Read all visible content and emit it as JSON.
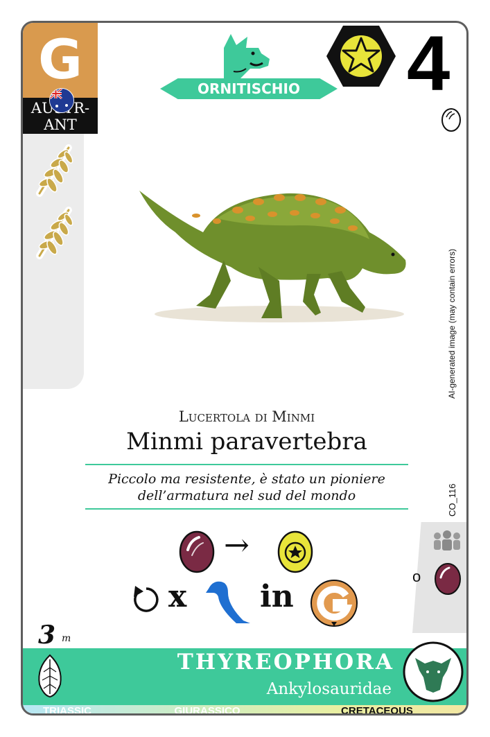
{
  "card": {
    "region_letter": "G",
    "region_label": "AUSTR-\nANT",
    "clade": "ORNITISCHIO",
    "points": "4",
    "common_name": "Lucertola di Minmi",
    "scientific_name": "Minmi paravertebra",
    "description_line1": "Piccolo ma resistente, è stato un pioniere",
    "description_line2": "dell’armatura nel sud del mondo",
    "ai_notice": "AI-generated image (may contain errors)",
    "card_code": "CO_116",
    "ability": {
      "arrow": "→",
      "x_label": "x",
      "in_label": "in",
      "region_letter": "G"
    },
    "alt_label": "o",
    "size_value": "3",
    "size_unit": "m",
    "group": "THYREOPHORA",
    "family": "Ankylosauridae",
    "periods": [
      "TRIASSIC",
      "GIURASSICO",
      "CRETACEOUS"
    ],
    "active_period": "CRETACEOUS"
  },
  "icons": {
    "diet_icons": [
      "fern-leaf-icon",
      "fern-leaf-icon"
    ],
    "star_icon": "star-hexagon-icon",
    "egg_icon": "egg-icon",
    "dino_silhouette": "triceratops-head-icon",
    "group_badge": "ankylosaur-head-icon"
  },
  "colors": {
    "accent_green": "#3ec99a",
    "region_orange": "#d99a4e",
    "egg_purple": "#7a2a44",
    "star_yellow": "#e8e43a",
    "sauropod_blue": "#1f6fd1"
  }
}
